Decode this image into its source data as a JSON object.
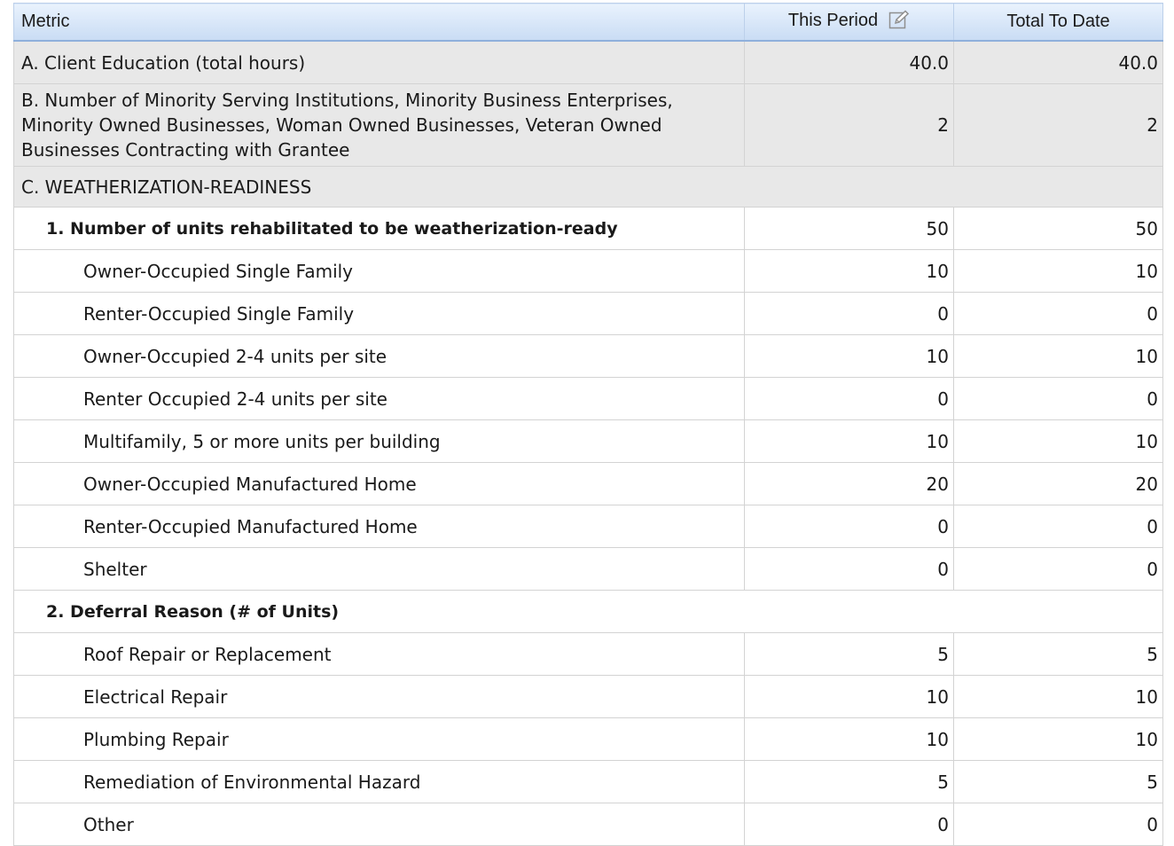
{
  "table": {
    "headers": {
      "metric": "Metric",
      "this_period": "This Period",
      "total_to_date": "Total To Date"
    },
    "row_a": {
      "label": "A. Client Education (total hours)",
      "this_period": "40.0",
      "total": "40.0"
    },
    "row_b": {
      "label": "B. Number of Minority Serving Institutions, Minority Business Enterprises, Minority Owned Businesses, Woman Owned Businesses, Veteran Owned Businesses Contracting with Grantee",
      "this_period": "2",
      "total": "2"
    },
    "section_c": {
      "label": "C. WEATHERIZATION-READINESS"
    },
    "group1": {
      "label": "1. Number of units rehabilitated to be weatherization-ready",
      "this_period": "50",
      "total": "50",
      "items": [
        {
          "label": "Owner-Occupied Single Family",
          "this_period": "10",
          "total": "10"
        },
        {
          "label": "Renter-Occupied Single Family",
          "this_period": "0",
          "total": "0"
        },
        {
          "label": "Owner-Occupied 2-4 units per site",
          "this_period": "10",
          "total": "10"
        },
        {
          "label": "Renter Occupied 2-4 units per site",
          "this_period": "0",
          "total": "0"
        },
        {
          "label": "Multifamily, 5 or more units per building",
          "this_period": "10",
          "total": "10"
        },
        {
          "label": "Owner-Occupied Manufactured Home",
          "this_period": "20",
          "total": "20"
        },
        {
          "label": "Renter-Occupied Manufactured Home",
          "this_period": "0",
          "total": "0"
        },
        {
          "label": "Shelter",
          "this_period": "0",
          "total": "0"
        }
      ]
    },
    "group2": {
      "label": "2. Deferral Reason (# of Units)",
      "items": [
        {
          "label": "Roof Repair or Replacement",
          "this_period": "5",
          "total": "5"
        },
        {
          "label": "Electrical Repair",
          "this_period": "10",
          "total": "10"
        },
        {
          "label": "Plumbing Repair",
          "this_period": "10",
          "total": "10"
        },
        {
          "label": "Remediation of Environmental Hazard",
          "this_period": "5",
          "total": "5"
        },
        {
          "label": "Other",
          "this_period": "0",
          "total": "0"
        }
      ]
    }
  },
  "icons": {
    "edit": "edit-icon"
  },
  "colors": {
    "header_gradient_top": "#e9f2fd",
    "header_gradient_bottom": "#c9dcf4",
    "grey_row": "#e8e8e8",
    "border": "#d3d3d3"
  }
}
